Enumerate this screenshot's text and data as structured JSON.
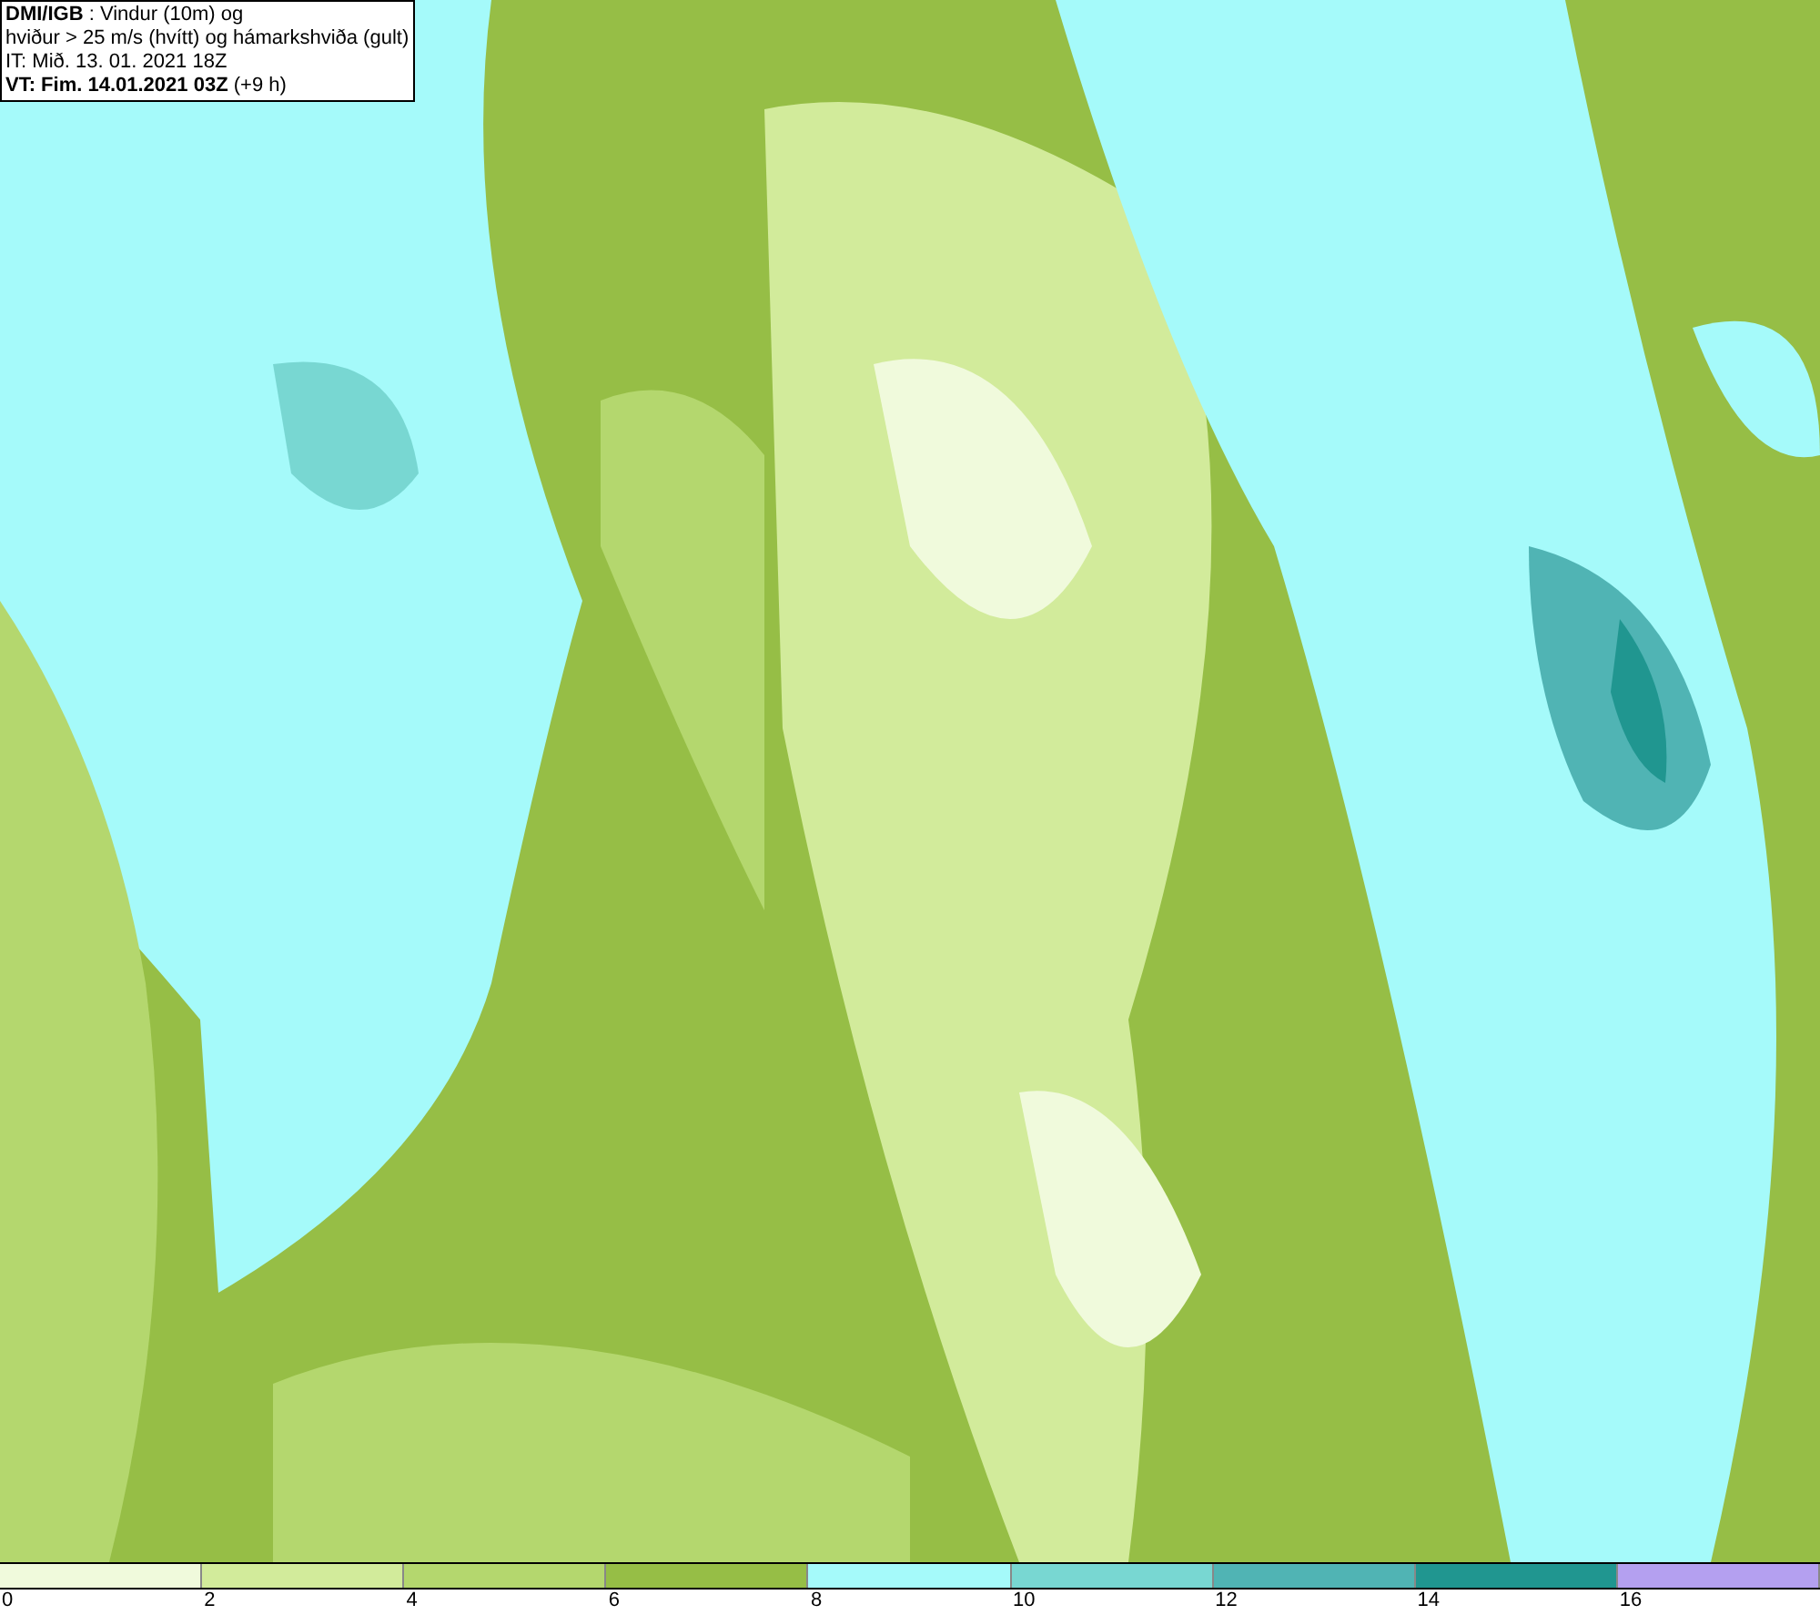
{
  "info_box": {
    "lines": [
      "**DMI/IGB** : Vindur (10m) og",
      "hviður > 25 m/s (hvítt) og hámarkshviða (gult)",
      "IT: Mið. 13. 01. 2021 18Z",
      "**VT: Fim. 14.01.2021 03Z** (+9 h)"
    ]
  },
  "legend": {
    "bins": [
      {
        "color": "#f0fadc"
      },
      {
        "color": "#d2eb9b"
      },
      {
        "color": "#b4d76e"
      },
      {
        "color": "#96be46"
      },
      {
        "color": "#a5fafa"
      },
      {
        "color": "#78d7d2"
      },
      {
        "color": "#50b4b4"
      },
      {
        "color": "#209690"
      },
      {
        "color": "#b4a0f0"
      }
    ],
    "ticks": [
      "0",
      "2",
      "4",
      "6",
      "8",
      "10",
      "12",
      "14",
      "16"
    ]
  }
}
